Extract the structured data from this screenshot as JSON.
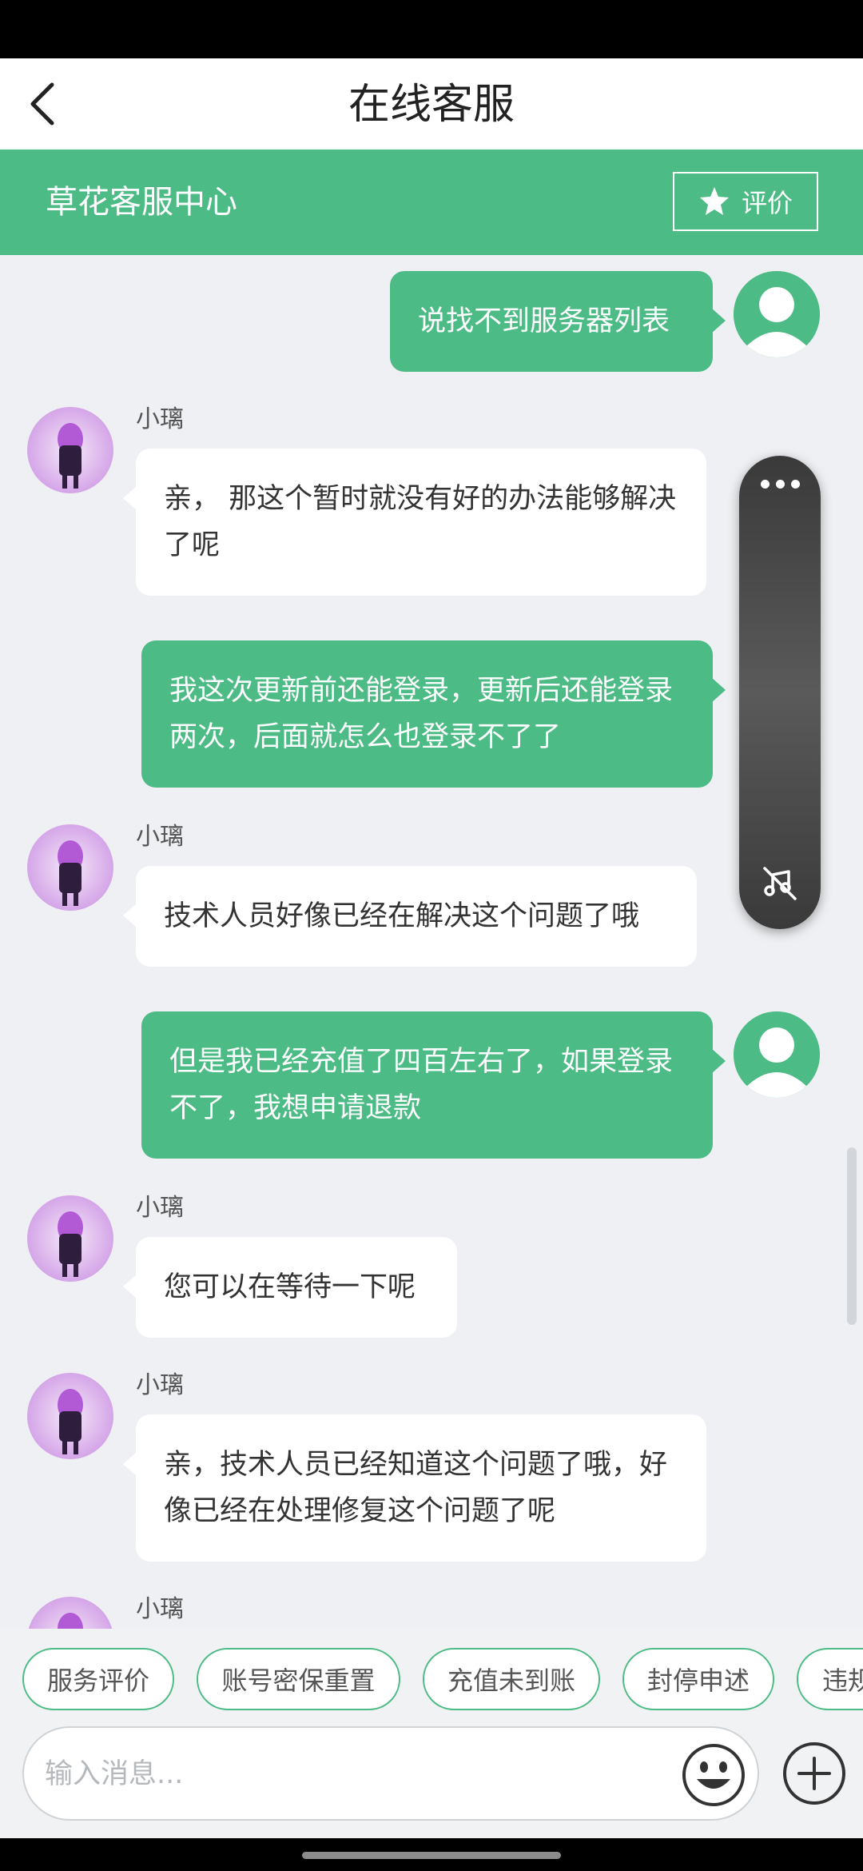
{
  "header": {
    "title": "在线客服"
  },
  "service_bar": {
    "center_name": "草花客服中心",
    "rate_label": "评价"
  },
  "messages": [
    {
      "from": "me",
      "text": "说找不到服务器列表"
    },
    {
      "from": "agent",
      "name": "小璃",
      "text": "亲， 那这个暂时就没有好的办法能够解决了呢"
    },
    {
      "from": "me",
      "text": "我这次更新前还能登录，更新后还能登录两次，后面就怎么也登录不了了"
    },
    {
      "from": "agent",
      "name": "小璃",
      "text": "技术人员好像已经在解决这个问题了哦"
    },
    {
      "from": "me",
      "text": "但是我已经充值了四百左右了，如果登录不了，我想申请退款"
    },
    {
      "from": "agent",
      "name": "小璃",
      "text": "您可以在等待一下呢"
    },
    {
      "from": "agent",
      "name": "小璃",
      "text": "亲，技术人员已经知道这个问题了哦，好像已经在处理修复这个问题了呢"
    },
    {
      "from": "agent",
      "name": "小璃",
      "text": ""
    }
  ],
  "quick_replies": [
    "服务评价",
    "账号密保重置",
    "充值未到账",
    "封停申述",
    "违规"
  ],
  "input": {
    "placeholder": "输入消息..."
  },
  "icons": {
    "back": "chevron-left-icon",
    "star": "star-icon",
    "more": "more-dots-icon",
    "mute": "mute-icon",
    "emoji": "emoji-icon",
    "plus": "plus-icon"
  },
  "colors": {
    "brand_green": "#4dbb85",
    "background": "#eef0f3"
  }
}
